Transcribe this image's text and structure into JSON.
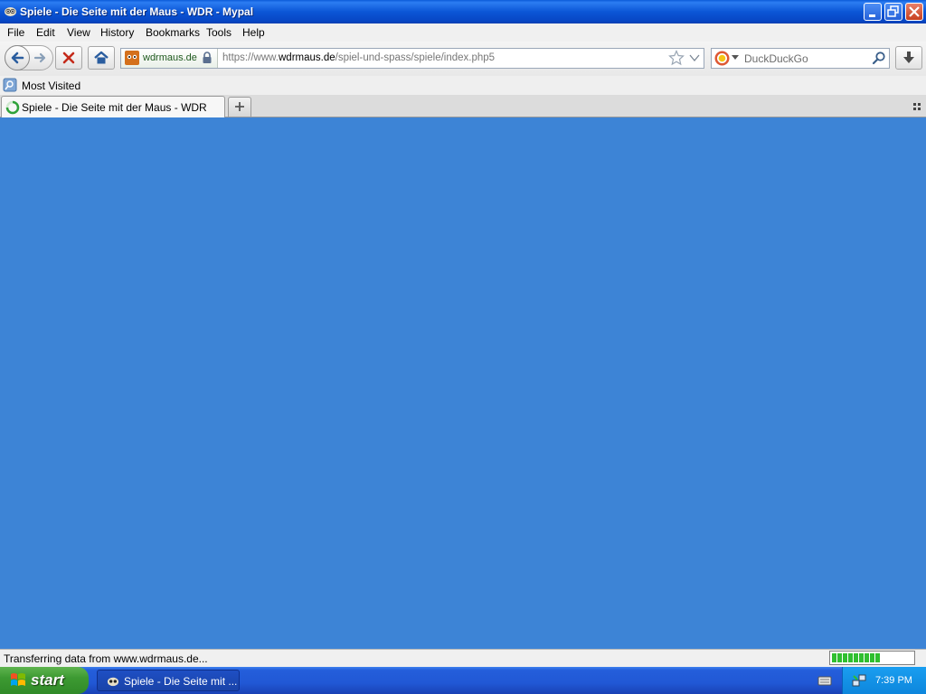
{
  "window": {
    "title": "Spiele - Die Seite mit der Maus - WDR - Mypal"
  },
  "menu": {
    "items": [
      "File",
      "Edit",
      "View",
      "History",
      "Bookmarks",
      "Tools",
      "Help"
    ]
  },
  "navigation": {
    "identity_label": "wdrmaus.de",
    "url_prefix": "https://www.",
    "url_domain": "wdrmaus.de",
    "url_path": "/spiel-und-spass/spiele/index.php5",
    "search_placeholder": "DuckDuckGo"
  },
  "bookmarks": {
    "most_visited": "Most Visited"
  },
  "tabs": [
    {
      "label": "Spiele - Die Seite mit der Maus - WDR",
      "active": true
    }
  ],
  "content": {
    "background_color": "#3d84d6"
  },
  "status": {
    "text": "Transferring data from www.wdrmaus.de...",
    "progress_fraction": 0.6
  },
  "taskbar": {
    "start_label": "start",
    "task_label": "Spiele - Die Seite mit ...",
    "clock": "7:39 PM"
  },
  "icons": [
    "mypal-icon",
    "minimize-icon",
    "restore-icon",
    "close-icon",
    "back-icon",
    "forward-icon",
    "stop-icon",
    "home-icon",
    "site-favicon",
    "lock-icon",
    "star-icon",
    "dropdown-icon",
    "duckduckgo-icon",
    "search-icon",
    "download-icon",
    "bookmark-folder-icon",
    "loading-icon",
    "plus-icon",
    "tab-list-icon",
    "windows-logo-icon",
    "keyboard-icon",
    "network-icon"
  ]
}
